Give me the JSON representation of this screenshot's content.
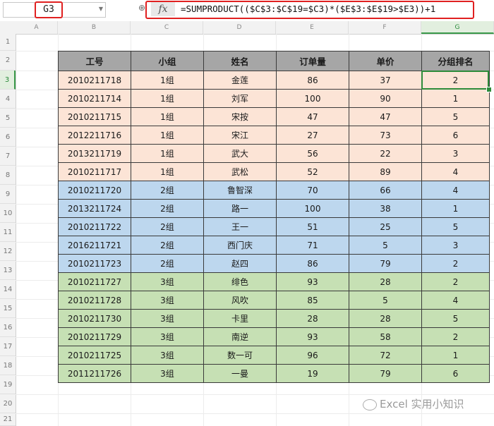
{
  "formula_bar": {
    "name_box": "G3",
    "fx_label": "fx",
    "formula": "=SUMPRODUCT(($C$3:$C$19=$C3)*($E$3:$E$19>$E3))+1"
  },
  "columns": [
    "A",
    "B",
    "C",
    "D",
    "E",
    "F",
    "G"
  ],
  "rows": [
    "1",
    "2",
    "3",
    "4",
    "5",
    "6",
    "7",
    "8",
    "9",
    "10",
    "11",
    "12",
    "13",
    "14",
    "15",
    "16",
    "17",
    "18",
    "19",
    "20",
    "21"
  ],
  "table": {
    "headers": [
      "工号",
      "小组",
      "姓名",
      "订单量",
      "单价",
      "分组排名"
    ],
    "rows": [
      [
        "2010211718",
        "1组",
        "金莲",
        "86",
        "37",
        "2"
      ],
      [
        "2010211714",
        "1组",
        "刘军",
        "100",
        "90",
        "1"
      ],
      [
        "2010211715",
        "1组",
        "宋按",
        "47",
        "47",
        "5"
      ],
      [
        "2012211716",
        "1组",
        "宋江",
        "27",
        "73",
        "6"
      ],
      [
        "2013211719",
        "1组",
        "武大",
        "56",
        "22",
        "3"
      ],
      [
        "2010211717",
        "1组",
        "武松",
        "52",
        "89",
        "4"
      ],
      [
        "2010211720",
        "2组",
        "鲁智深",
        "70",
        "66",
        "4"
      ],
      [
        "2013211724",
        "2组",
        "路一",
        "100",
        "38",
        "1"
      ],
      [
        "2010211722",
        "2组",
        "王一",
        "51",
        "25",
        "5"
      ],
      [
        "2016211721",
        "2组",
        "西门庆",
        "71",
        "5",
        "3"
      ],
      [
        "2010211723",
        "2组",
        "赵四",
        "86",
        "79",
        "2"
      ],
      [
        "2010211727",
        "3组",
        "绯色",
        "93",
        "28",
        "2"
      ],
      [
        "2010211728",
        "3组",
        "风吹",
        "85",
        "5",
        "4"
      ],
      [
        "2010211730",
        "3组",
        "卡里",
        "28",
        "28",
        "5"
      ],
      [
        "2010211729",
        "3组",
        "南逆",
        "93",
        "58",
        "2"
      ],
      [
        "2010211725",
        "3组",
        "数一可",
        "96",
        "72",
        "1"
      ],
      [
        "2011211726",
        "3组",
        "一曼",
        "19",
        "79",
        "6"
      ]
    ]
  },
  "watermark": "Excel 实用小知识"
}
